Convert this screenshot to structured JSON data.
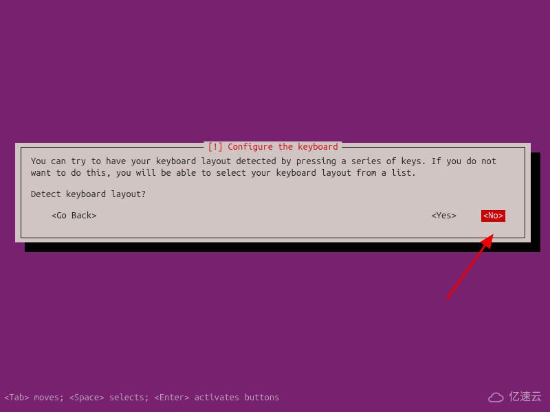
{
  "dialog": {
    "title": "[!] Configure the keyboard",
    "body_text": "You can try to have your keyboard layout detected by pressing a series of keys. If you do not want to do this, you will be able to select your keyboard layout from a list.",
    "prompt": "Detect keyboard layout?",
    "buttons": {
      "go_back": "<Go Back>",
      "yes": "<Yes>",
      "no": "<No>"
    }
  },
  "hint_bar": "<Tab> moves; <Space> selects; <Enter> activates buttons",
  "watermark": "亿速云"
}
